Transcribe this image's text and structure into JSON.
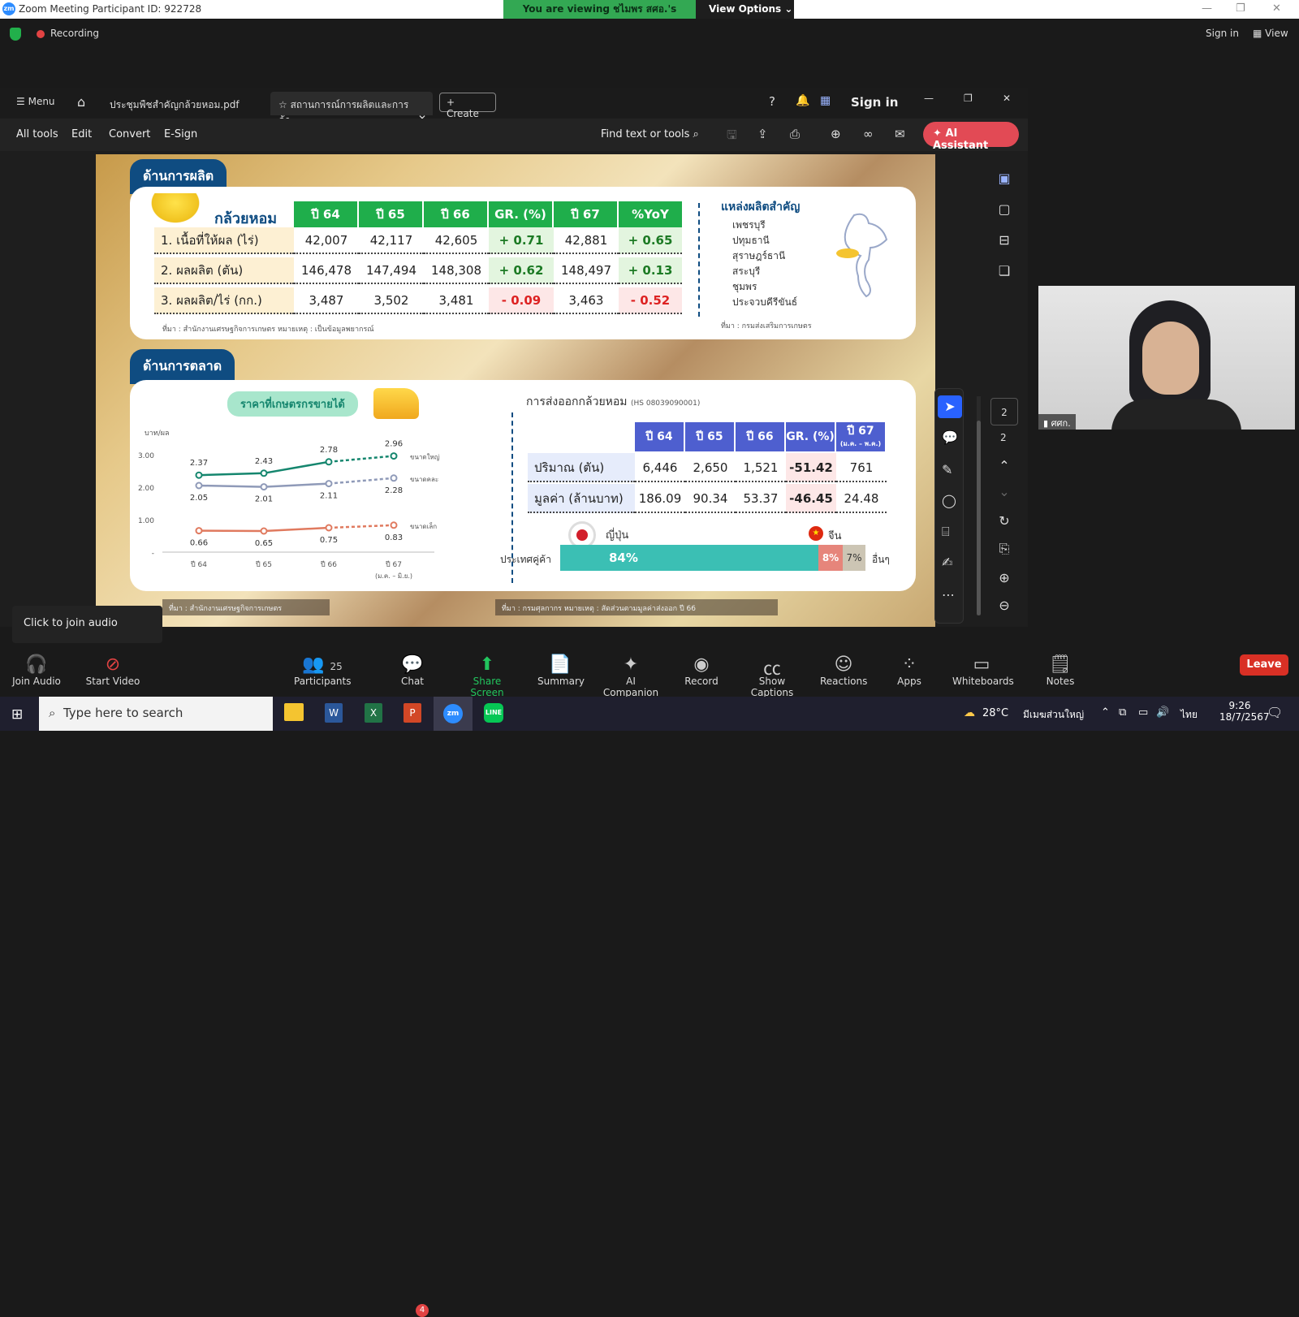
{
  "zoom": {
    "window_title": "Zoom Meeting Participant ID: 922728",
    "viewing_notice": "You are viewing ชไมพร สศอ.'s screen",
    "view_options": "View Options",
    "recording": "Recording",
    "sign_in": "Sign in",
    "view": "View",
    "click_audio": "Click to join audio",
    "participant_name": "ศศก.",
    "bottom": {
      "join_audio": "Join Audio",
      "start_video": "Start Video",
      "participants": "Participants",
      "participants_count": "25",
      "chat": "Chat",
      "chat_badge": "4",
      "share_screen": "Share Screen",
      "summary": "Summary",
      "ai_companion": "AI Companion",
      "record": "Record",
      "show_captions": "Show Captions",
      "reactions": "Reactions",
      "apps": "Apps",
      "whiteboards": "Whiteboards",
      "notes": "Notes",
      "leave": "Leave"
    }
  },
  "acrobat": {
    "menu": "Menu",
    "tab1": "ประชุมพืชสำคัญกล้วยหอม.pdf",
    "tab2": "สถานการณ์การผลิตและการค้า...",
    "create": "Create",
    "sign_in": "Sign in",
    "tools": [
      "All tools",
      "Edit",
      "Convert",
      "E-Sign"
    ],
    "find": "Find text or tools",
    "ai_assistant": "AI Assistant",
    "page_num": "2",
    "page_total": "2"
  },
  "slide": {
    "production": {
      "title": "ด้านการผลิต",
      "product": "กล้วยหอม",
      "headers": [
        "ปี 64",
        "ปี 65",
        "ปี 66",
        "GR. (%)",
        "ปี 67",
        "%YoY"
      ],
      "rows": [
        {
          "label": "1. เนื้อที่ให้ผล (ไร่)",
          "values": [
            "42,007",
            "42,117",
            "42,605",
            "+ 0.71",
            "42,881",
            "+ 0.65"
          ]
        },
        {
          "label": "2. ผลผลิต (ตัน)",
          "values": [
            "146,478",
            "147,494",
            "148,308",
            "+ 0.62",
            "148,497",
            "+ 0.13"
          ]
        },
        {
          "label": "3. ผลผลิต/ไร่ (กก.)",
          "values": [
            "3,487",
            "3,502",
            "3,481",
            "- 0.09",
            "3,463",
            "- 0.52"
          ]
        }
      ],
      "source": "ที่มา : สำนักงานเศรษฐกิจการเกษตร   หมายเหตุ : เป็นข้อมูลพยากรณ์",
      "areas_title": "แหล่งผลิตสำคัญ",
      "areas": [
        "เพชรบุรี",
        "ปทุมธานี",
        "สุราษฎร์ธานี",
        "สระบุรี",
        "ชุมพร",
        "ประจวบคีรีขันธ์"
      ],
      "areas_source": "ที่มา : กรมส่งเสริมการเกษตร"
    },
    "market": {
      "title": "ด้านการตลาด",
      "price_title": "ราคาที่เกษตรกรขายได้",
      "price_source": "ที่มา : สำนักงานเศรษฐกิจการเกษตร",
      "export_title": "การส่งออกกล้วยหอม",
      "export_hs": "(HS 08039090001)",
      "export_headers": [
        "ปี 64",
        "ปี 65",
        "ปี 66",
        "GR. (%)",
        "ปี 67"
      ],
      "export_h5_sub": "(ม.ค. – พ.ค.)",
      "export_rows": [
        {
          "label": "ปริมาณ (ตัน)",
          "values": [
            "6,446",
            "2,650",
            "1,521",
            "-51.42",
            "761"
          ]
        },
        {
          "label": "มูลค่า (ล้านบาท)",
          "values": [
            "186.09",
            "90.34",
            "53.37",
            "-46.45",
            "24.48"
          ]
        }
      ],
      "partner_label": "ประเทศคู่ค้า",
      "japan": "ญี่ปุ่น",
      "china": "จีน",
      "others": "อื่นๆ",
      "japan_share": "84%",
      "china_share": "8%",
      "others_share": "7%",
      "export_source": "ที่มา : กรมศุลกากร   หมายเหตุ : สัดส่วนตามมูลค่าส่งออก ปี 66"
    }
  },
  "chart_data": {
    "type": "line",
    "ylabel": "บาท/ผล",
    "categories": [
      "ปี 64",
      "ปี 65",
      "ปี 66",
      "ปี 67"
    ],
    "x_sub": "(ม.ค. – มิ.ย.)",
    "ylim": [
      0,
      3.3
    ],
    "yticks": [
      "3.00",
      "2.00",
      "1.00",
      "-"
    ],
    "series": [
      {
        "name": "ขนาดใหญ่",
        "values": [
          2.37,
          2.43,
          2.78,
          2.96
        ],
        "color": "#15866e"
      },
      {
        "name": "ขนาดคละ",
        "values": [
          2.05,
          2.01,
          2.11,
          2.28
        ],
        "color": "#8f9ab8"
      },
      {
        "name": "ขนาดเล็ก",
        "values": [
          0.66,
          0.65,
          0.75,
          0.83
        ],
        "color": "#e07a5f"
      }
    ]
  },
  "taskbar": {
    "search": "Type here to search",
    "weather": "28°C",
    "weather_txt": "มีเมฆส่วนใหญ่",
    "lang": "ไทย",
    "time": "9:26",
    "date": "18/7/2567"
  }
}
